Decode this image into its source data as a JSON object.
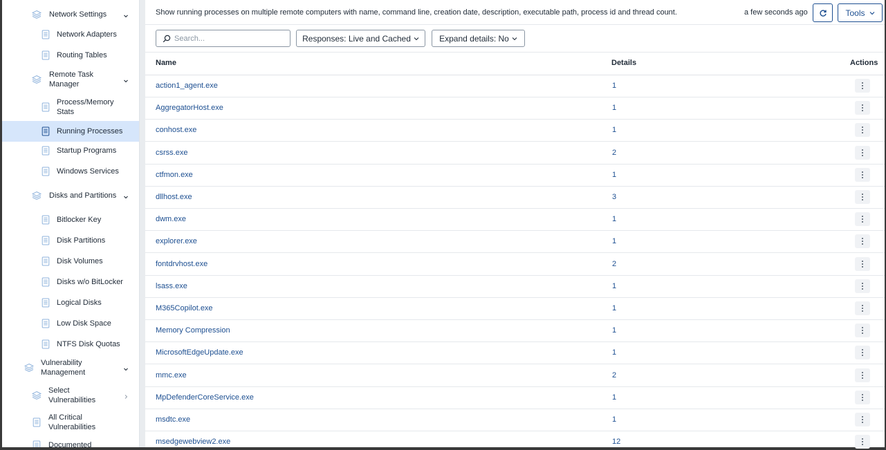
{
  "sidebar": {
    "items": [
      {
        "label": "Network Settings",
        "type": "group",
        "chevron": "down"
      },
      {
        "label": "Network Adapters",
        "type": "report"
      },
      {
        "label": "Routing Tables",
        "type": "report"
      },
      {
        "label": "Remote Task Manager",
        "type": "group",
        "chevron": "down"
      },
      {
        "label": "Process/Memory Stats",
        "type": "report"
      },
      {
        "label": "Running Processes",
        "type": "report",
        "active": true
      },
      {
        "label": "Startup Programs",
        "type": "report"
      },
      {
        "label": "Windows Services",
        "type": "report"
      },
      {
        "label": "Disks and Partitions",
        "type": "group",
        "chevron": "down"
      },
      {
        "label": "Bitlocker Key",
        "type": "report"
      },
      {
        "label": "Disk Partitions",
        "type": "report"
      },
      {
        "label": "Disk Volumes",
        "type": "report"
      },
      {
        "label": "Disks w/o BitLocker",
        "type": "report"
      },
      {
        "label": "Logical Disks",
        "type": "report"
      },
      {
        "label": "Low Disk Space",
        "type": "report"
      },
      {
        "label": "NTFS Disk Quotas",
        "type": "report"
      },
      {
        "label": "Vulnerability Management",
        "type": "group",
        "chevron": "down"
      },
      {
        "label": "Select Vulnerabilities",
        "type": "group",
        "chevron": "right"
      },
      {
        "label": "All Critical Vulnerabilities",
        "type": "report"
      },
      {
        "label": "Documented",
        "type": "report"
      }
    ]
  },
  "header": {
    "description": "Show running processes on multiple remote computers with name, command line, creation date, description, executable path, process id and thread count.",
    "updated": "a few seconds ago",
    "tools_label": "Tools"
  },
  "filters": {
    "search_placeholder": "Search...",
    "responses_label": "Responses: Live and Cached",
    "expand_label": "Expand details: No"
  },
  "table": {
    "columns": [
      "Name",
      "Details",
      "Actions"
    ],
    "rows": [
      {
        "name": "action1_agent.exe",
        "details": "1"
      },
      {
        "name": "AggregatorHost.exe",
        "details": "1"
      },
      {
        "name": "conhost.exe",
        "details": "1"
      },
      {
        "name": "csrss.exe",
        "details": "2"
      },
      {
        "name": "ctfmon.exe",
        "details": "1"
      },
      {
        "name": "dllhost.exe",
        "details": "3"
      },
      {
        "name": "dwm.exe",
        "details": "1"
      },
      {
        "name": "explorer.exe",
        "details": "1"
      },
      {
        "name": "fontdrvhost.exe",
        "details": "2"
      },
      {
        "name": "lsass.exe",
        "details": "1"
      },
      {
        "name": "M365Copilot.exe",
        "details": "1"
      },
      {
        "name": "Memory Compression",
        "details": "1"
      },
      {
        "name": "MicrosoftEdgeUpdate.exe",
        "details": "1"
      },
      {
        "name": "mmc.exe",
        "details": "2"
      },
      {
        "name": "MpDefenderCoreService.exe",
        "details": "1"
      },
      {
        "name": "msdtc.exe",
        "details": "1"
      },
      {
        "name": "msedgewebview2.exe",
        "details": "12"
      }
    ]
  },
  "colors": {
    "accent": "#1d4f91",
    "active_bg": "#d6e6fb",
    "icon": "#8fb3dc"
  }
}
